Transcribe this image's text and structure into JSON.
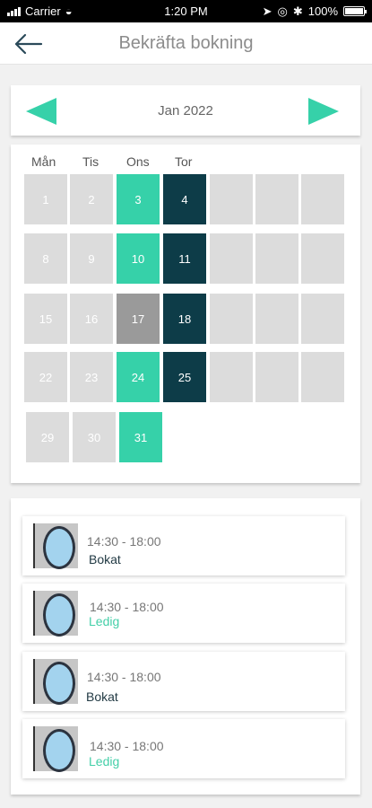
{
  "status_bar": {
    "carrier": "Carrier",
    "time": "1:20 PM",
    "battery": "100%"
  },
  "header": {
    "title": "Bekräfta bokning"
  },
  "calendar": {
    "month": "Jan 2022",
    "weekdays": [
      "Mån",
      "Tis",
      "Ons",
      "Tor"
    ],
    "days": [
      "1",
      "2",
      "3",
      "4",
      "8",
      "9",
      "10",
      "11",
      "15",
      "16",
      "17",
      "18",
      "22",
      "23",
      "24",
      "25",
      "29",
      "30",
      "31"
    ]
  },
  "slots": [
    {
      "time": "14:30 - 18:00",
      "status": "Bokat"
    },
    {
      "time": "14:30 - 18:00",
      "status": "Ledig"
    },
    {
      "time": "14:30 - 18:00",
      "status": "Bokat"
    },
    {
      "time": "14:30 - 18:00",
      "status": "Ledig"
    }
  ],
  "colors": {
    "accent": "#36d1a9",
    "booked_day": "#0d3c48",
    "past_day": "#9a9a9a",
    "empty_day": "#dcdcdc"
  }
}
